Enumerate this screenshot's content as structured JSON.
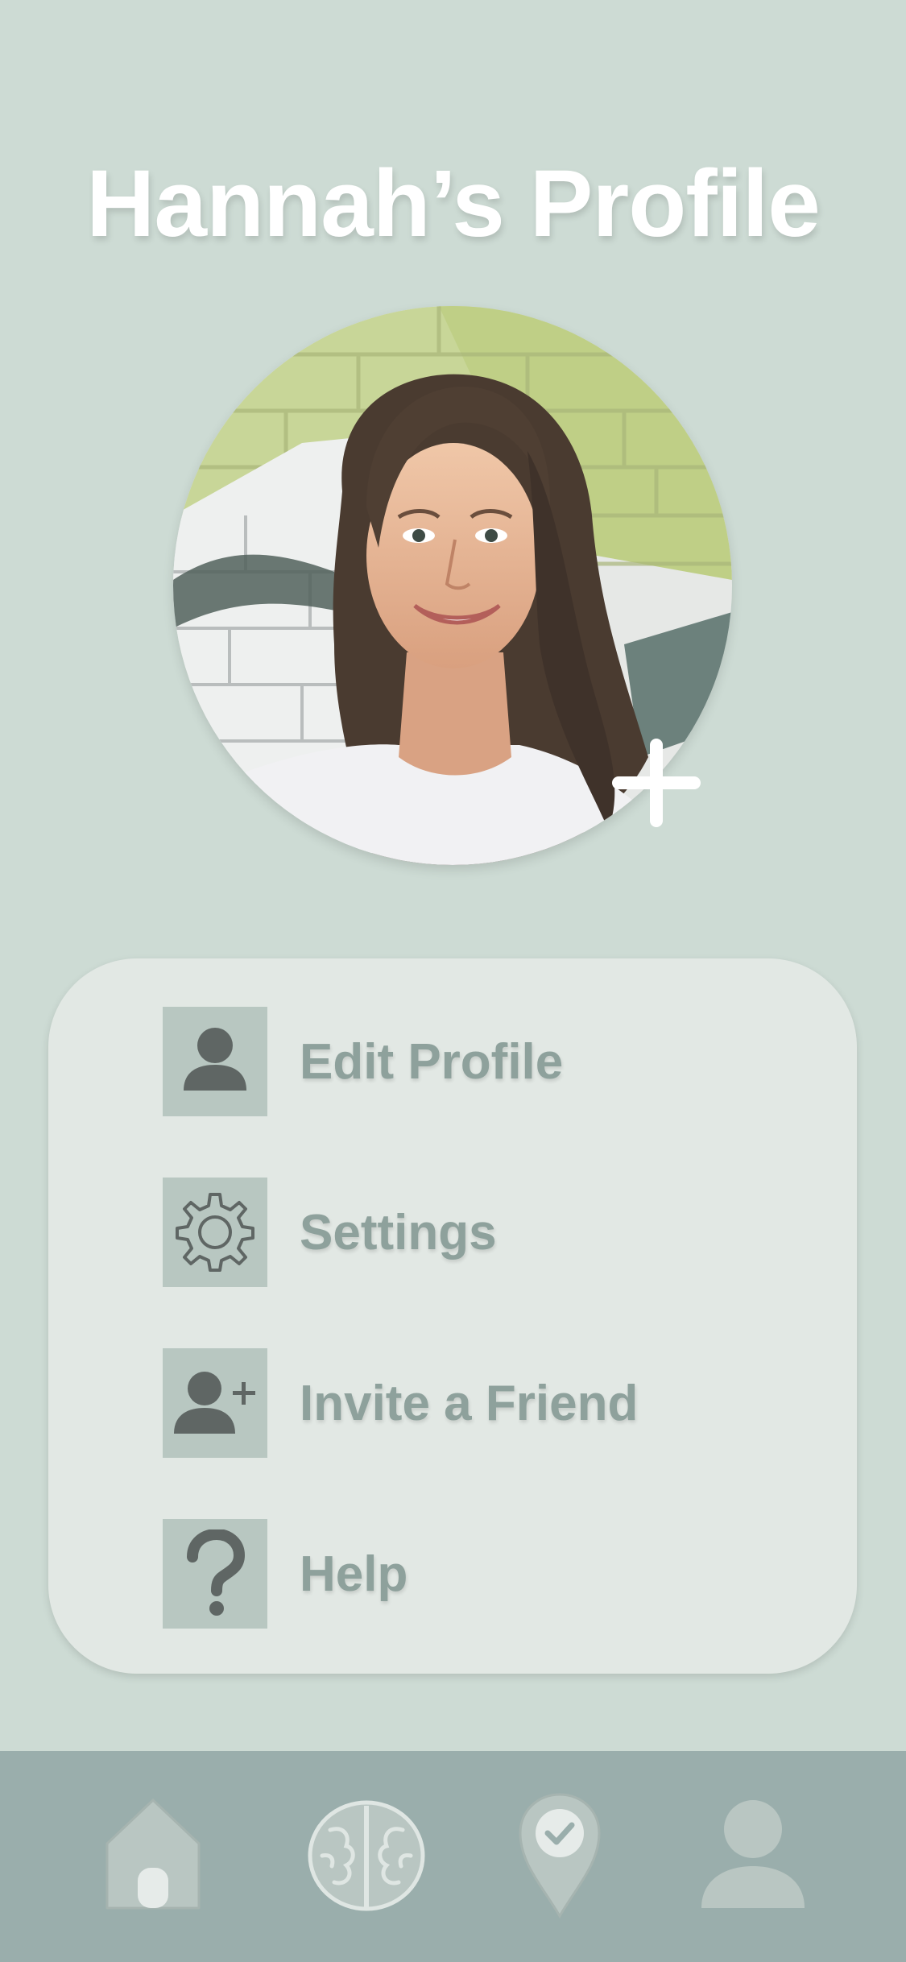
{
  "header": {
    "title": "Hannah’s Profile"
  },
  "avatar": {
    "add_photo_icon": "plus-icon"
  },
  "menu": {
    "items": [
      {
        "label": "Edit Profile",
        "icon": "person-icon"
      },
      {
        "label": "Settings",
        "icon": "gear-icon"
      },
      {
        "label": "Invite a Friend",
        "icon": "add-person-icon"
      },
      {
        "label": "Help",
        "icon": "question-mark-icon"
      }
    ]
  },
  "tabbar": {
    "tabs": [
      {
        "name": "home",
        "icon": "home-icon"
      },
      {
        "name": "brain",
        "icon": "brain-icon"
      },
      {
        "name": "check-in",
        "icon": "location-check-icon"
      },
      {
        "name": "profile",
        "icon": "profile-icon",
        "active": true
      }
    ]
  },
  "colors": {
    "background": "#cddbd4",
    "card": "#e2e8e4",
    "icon_tile": "#b8c7c1",
    "label": "#8ea19c",
    "tabbar": "#9aaeac"
  }
}
